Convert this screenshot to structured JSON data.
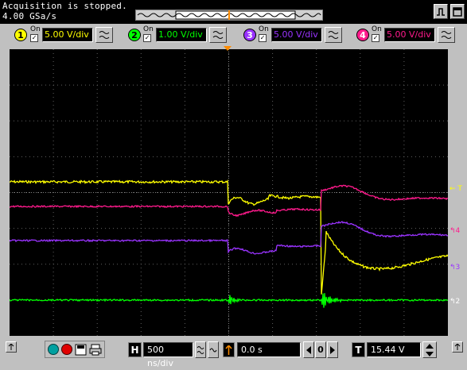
{
  "status": {
    "line1": "Acquisition is stopped.",
    "line2": "4.00 GSa/s"
  },
  "channels": [
    {
      "num": "1",
      "on_label": "On",
      "scale": "5.00 V/div",
      "color": "#ffff00",
      "checked": "✓"
    },
    {
      "num": "2",
      "on_label": "On",
      "scale": "1.00 V/div",
      "color": "#00ff00",
      "checked": "✓"
    },
    {
      "num": "3",
      "on_label": "On",
      "scale": "5.00 V/div",
      "color": "#9a33ff",
      "checked": "✓"
    },
    {
      "num": "4",
      "on_label": "On",
      "scale": "5.00 V/div",
      "color": "#ff1a8c",
      "checked": "✓"
    }
  ],
  "markers": {
    "trigger": "← T",
    "ch4": "↰4",
    "ch3": "↰3",
    "ch2": "↰2"
  },
  "bottom": {
    "h_label": "H",
    "timebase": "500 ns/div",
    "delay": "0.0 s",
    "t_label": "T",
    "trigger_level": "15.44 V",
    "stop_label": "0"
  },
  "icons": [
    "single-trace-icon",
    "fullscreen-icon",
    "pointer-up-icon",
    "run-icon",
    "stop-icon",
    "print-icon",
    "disk-icon"
  ]
}
